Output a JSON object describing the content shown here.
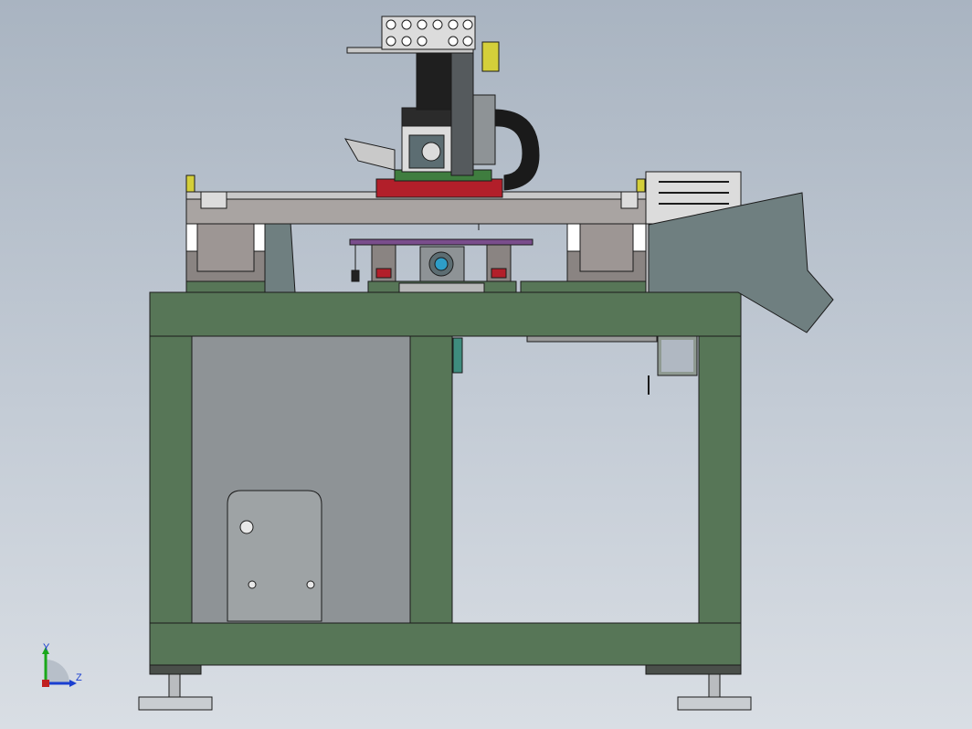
{
  "viewport": {
    "background_top": "#a9b4c1",
    "background_bottom": "#d9dee4"
  },
  "colors": {
    "frame_green": "#577657",
    "panel_gray": "#8e9396",
    "rail_gray": "#b7b8b8",
    "block_gray": "#8a8482",
    "hopper_gray": "#6f7f80",
    "purple_bar": "#7a4d8c",
    "red_carriage": "#b21f2a",
    "carriage_green": "#3f7d3f",
    "cable_black": "#1a1a1a",
    "accent_yellow": "#d4cf3a"
  },
  "triad": {
    "y_label": "Y",
    "z_label": "Z",
    "y_axis_color": "#1aa81a",
    "z_axis_color": "#1a3fd0"
  }
}
